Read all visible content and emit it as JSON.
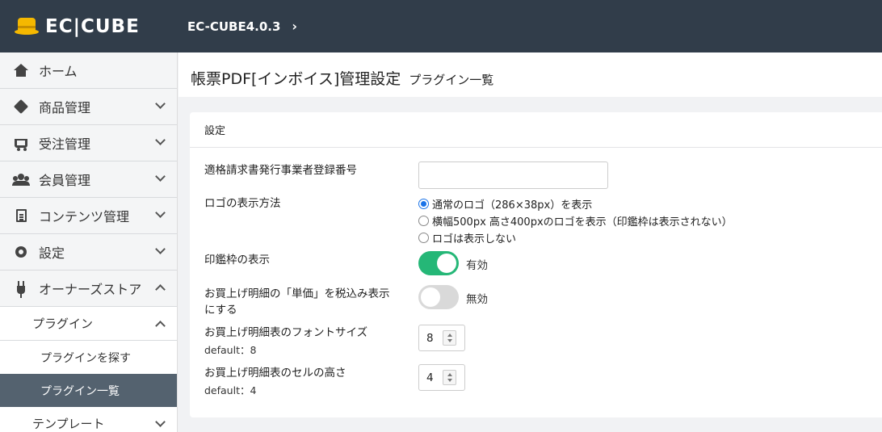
{
  "header": {
    "logo_text": "EC|CUBE",
    "version": "EC-CUBE4.0.3"
  },
  "sidebar": {
    "items": [
      {
        "label": "ホーム",
        "icon": "home-icon"
      },
      {
        "label": "商品管理",
        "icon": "box-icon"
      },
      {
        "label": "受注管理",
        "icon": "cart-icon"
      },
      {
        "label": "会員管理",
        "icon": "users-icon"
      },
      {
        "label": "コンテンツ管理",
        "icon": "file-icon"
      },
      {
        "label": "設定",
        "icon": "gear-icon"
      },
      {
        "label": "オーナーズストア",
        "icon": "plug-icon"
      }
    ],
    "plugin_group": "プラグイン",
    "plugin_search": "プラグインを探す",
    "plugin_list": "プラグイン一覧",
    "template_group": "テンプレート"
  },
  "page": {
    "title": "帳票PDF[インボイス]管理設定",
    "subtitle": "プラグイン一覧"
  },
  "card": {
    "header": "設定",
    "registration_label": "適格請求書発行事業者登録番号",
    "registration_value": "",
    "logo_label": "ロゴの表示方法",
    "logo_options": [
      "通常のロゴ（286×38px）を表示",
      "横幅500px 高さ400pxのロゴを表示（印鑑枠は表示されない）",
      "ロゴは表示しない"
    ],
    "logo_selected_index": 0,
    "stamp_label": "印鑑枠の表示",
    "stamp_state": "有効",
    "tax_label": "お買上げ明細の「単価」を税込み表示にする",
    "tax_state": "無効",
    "font_size_label": "お買上げ明細表のフォントサイズ",
    "font_size_default": "default：8",
    "font_size_value": "8",
    "cell_height_label": "お買上げ明細表のセルの高さ",
    "cell_height_default": "default：4",
    "cell_height_value": "4"
  },
  "colors": {
    "topbar": "#313d4a",
    "toggle_on": "#25b777",
    "toggle_off": "#d9d9d9",
    "active_nav": "#54626f",
    "radio_accent": "#1a73e8"
  }
}
